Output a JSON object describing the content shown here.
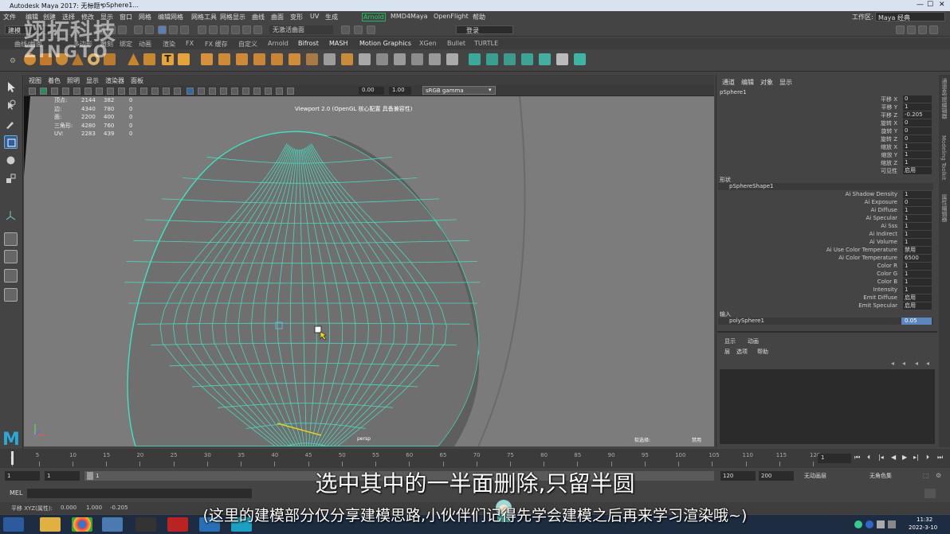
{
  "window": {
    "title": "Autodesk Maya 2017: 无标题*",
    "separator": "---",
    "tab": "pSphere1..."
  },
  "menubar": {
    "items": [
      "文件",
      "编辑",
      "创建",
      "选择",
      "修改",
      "显示",
      "窗口",
      "网格",
      "编辑网格",
      "网格工具",
      "网格显示",
      "曲线",
      "曲面",
      "变形",
      "UV",
      "生成",
      "Arnold",
      "MMD4Maya",
      "OpenFlight",
      "帮助"
    ],
    "workspace_label": "工作区:",
    "workspace_value": "Maya 经典"
  },
  "statusline": {
    "mode": "建模",
    "live_surface": "无激活曲面",
    "login": "登录"
  },
  "shelf_tabs": [
    "曲线/曲面",
    "多边形",
    "雕刻",
    "绑定",
    "动画",
    "渲染",
    "FX",
    "FX 缓存",
    "自定义",
    "Arnold",
    "Bifrost",
    "MASH",
    "Motion Graphics",
    "XGen",
    "Bullet",
    "TURTLE"
  ],
  "watermark": {
    "cn": "翊拓科技",
    "en": "ZINGTO"
  },
  "viewport": {
    "menu": [
      "视图",
      "着色",
      "照明",
      "显示",
      "渲染器",
      "面板"
    ],
    "exposure": "0.00",
    "gamma": "1.00",
    "colorspace": "sRGB gamma",
    "title": "Viewport 2.0 (OpenGL 核心配置 具备兼容性)",
    "camera": "persp",
    "hud_bottom_left": "软选择:",
    "hud_bottom_right": "禁用",
    "hud": [
      {
        "label": "顶点:",
        "v1": "2144",
        "v2": "382",
        "v3": "0"
      },
      {
        "label": "边:",
        "v1": "4340",
        "v2": "780",
        "v3": "0"
      },
      {
        "label": "面:",
        "v1": "2200",
        "v2": "400",
        "v3": "0"
      },
      {
        "label": "三角形:",
        "v1": "4280",
        "v2": "760",
        "v3": "0"
      },
      {
        "label": "UV:",
        "v1": "2283",
        "v2": "439",
        "v3": "0"
      }
    ]
  },
  "channelbox": {
    "menu": [
      "通道",
      "编辑",
      "对象",
      "显示"
    ],
    "object": "pSphere1",
    "transform": [
      {
        "label": "平移 X",
        "value": "0"
      },
      {
        "label": "平移 Y",
        "value": "1"
      },
      {
        "label": "平移 Z",
        "value": "-0.205"
      },
      {
        "label": "旋转 X",
        "value": "0"
      },
      {
        "label": "旋转 Y",
        "value": "0"
      },
      {
        "label": "旋转 Z",
        "value": "0"
      },
      {
        "label": "缩放 X",
        "value": "1"
      },
      {
        "label": "缩放 Y",
        "value": "1"
      },
      {
        "label": "缩放 Z",
        "value": "1"
      },
      {
        "label": "可见性",
        "value": "启用"
      }
    ],
    "shapes_label": "形状",
    "shape_name": "pSphereShape1",
    "shape_attrs": [
      {
        "label": "Ai Shadow Density",
        "value": "1"
      },
      {
        "label": "Ai Exposure",
        "value": "0"
      },
      {
        "label": "Ai Diffuse",
        "value": "1"
      },
      {
        "label": "Ai Specular",
        "value": "1"
      },
      {
        "label": "Ai Sss",
        "value": "1"
      },
      {
        "label": "Ai Indirect",
        "value": "1"
      },
      {
        "label": "Ai Volume",
        "value": "1"
      },
      {
        "label": "Ai Use Color Temperature",
        "value": "禁用"
      },
      {
        "label": "Ai Color Temperature",
        "value": "6500"
      },
      {
        "label": "Color R",
        "value": "1"
      },
      {
        "label": "Color G",
        "value": "1"
      },
      {
        "label": "Color B",
        "value": "1"
      },
      {
        "label": "Intensity",
        "value": "1"
      },
      {
        "label": "Emit Diffuse",
        "value": "启用"
      },
      {
        "label": "Emit Specular",
        "value": "启用"
      }
    ],
    "inputs_label": "输入",
    "input_name": "polySphere1",
    "input_value": "0.05",
    "layer_tabs": [
      "显示",
      "动画"
    ],
    "layer_menu": [
      "层",
      "选项",
      "帮助"
    ]
  },
  "side_tabs": [
    "通道盒/层编辑器",
    "Modeling Toolkit",
    "属性编辑器"
  ],
  "timeline": {
    "ticks": [
      "1",
      "5",
      "10",
      "15",
      "20",
      "25",
      "30",
      "35",
      "40",
      "45",
      "50",
      "55",
      "60",
      "65",
      "70",
      "75",
      "80",
      "85",
      "90",
      "95",
      "100",
      "105",
      "110",
      "115",
      "120"
    ],
    "current_frame": "1"
  },
  "range": {
    "start": "1",
    "start2": "1",
    "slider_value": "1",
    "end": "120",
    "end2": "200",
    "anim_layer": "无动画层",
    "char_set": "无角色集"
  },
  "cmdline": {
    "label": "MEL"
  },
  "helpline": {
    "text": "平移 XYZ(属性):",
    "v1": "0.000",
    "v2": "1.000",
    "v3": "-0.205"
  },
  "subtitles": {
    "main": "选中其中的一半面删除,只留半圆",
    "secondary": "(这里的建模部分仅分享建模思路,小伙伴们记得先学会建模之后再来学习渲染哦~)"
  },
  "taskbar": {
    "time": "11:32",
    "date": "2022-3-10"
  }
}
